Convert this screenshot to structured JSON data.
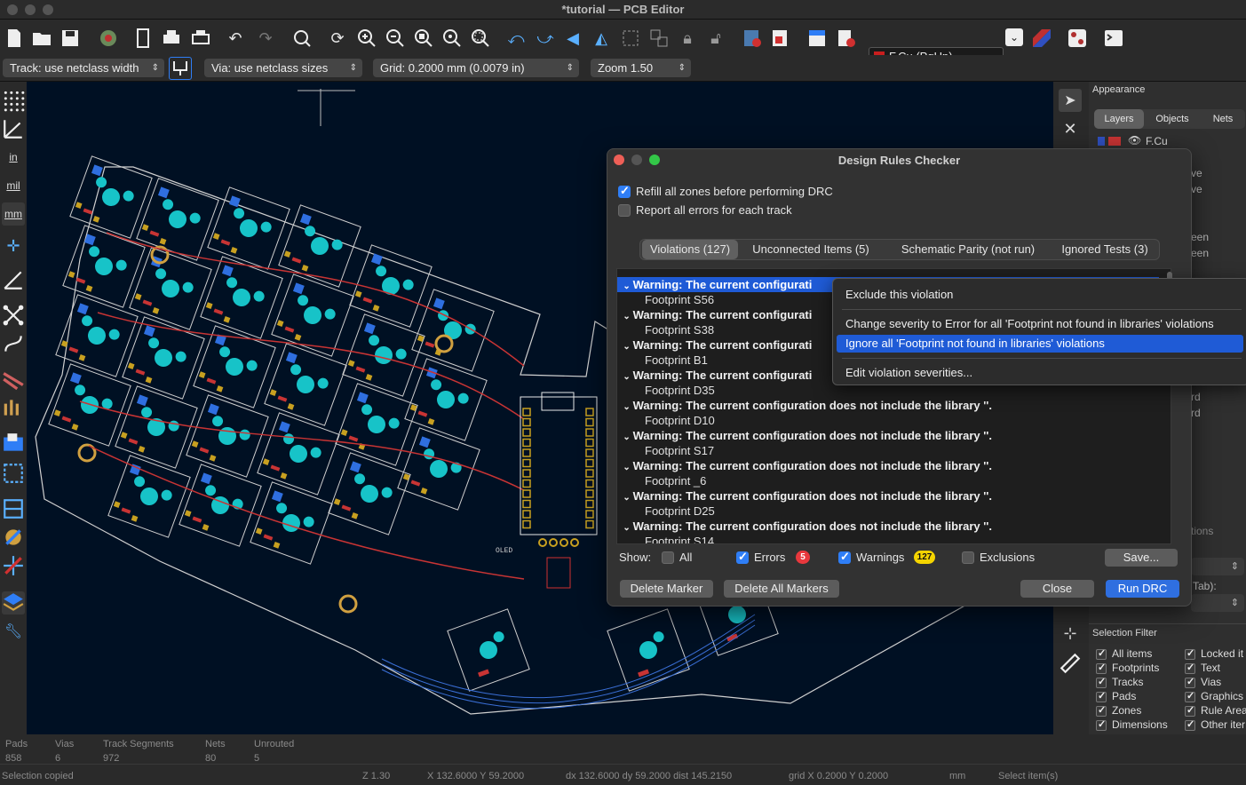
{
  "window": {
    "title": "*tutorial — PCB Editor"
  },
  "toolbar": {
    "layer_selector": "F.Cu (PgUp)",
    "track_width": "Track: use netclass width",
    "via_size": "Via: use netclass sizes",
    "grid": "Grid: 0.2000 mm (0.0079 in)",
    "zoom": "Zoom 1.50"
  },
  "left_tools": {
    "in_label": "in",
    "mil_label": "mil",
    "mm_label": "mm"
  },
  "canvas": {
    "silk_label": "OLED"
  },
  "appearance": {
    "title": "Appearance",
    "tabs": [
      "Layers",
      "Objects",
      "Nets"
    ],
    "first_layer": "F.Cu",
    "peek_texts": [
      "ve",
      "ve",
      "een",
      "een",
      "rd",
      "rd",
      "tions",
      "Tab):"
    ]
  },
  "selection_filter": {
    "title": "Selection Filter",
    "items": [
      "All items",
      "Locked it",
      "Footprints",
      "Text",
      "Tracks",
      "Vias",
      "Pads",
      "Graphics",
      "Zones",
      "Rule Area",
      "Dimensions",
      "Other iter"
    ]
  },
  "drc": {
    "title": "Design Rules Checker",
    "refill_zones": "Refill all zones before performing DRC",
    "report_all_errors": "Report all errors for each track",
    "tabs": [
      "Violations (127)",
      "Unconnected Items (5)",
      "Schematic Parity (not run)",
      "Ignored Tests (3)"
    ],
    "violations": [
      {
        "warning": "Warning: The current configurati",
        "item": "Footprint S56"
      },
      {
        "warning": "Warning: The current configurati",
        "item": "Footprint S38"
      },
      {
        "warning": "Warning: The current configurati",
        "item": "Footprint B1"
      },
      {
        "warning": "Warning: The current configurati",
        "item": "Footprint D35"
      },
      {
        "warning": "Warning: The current configuration does not include the library ''.",
        "item": "Footprint D10"
      },
      {
        "warning": "Warning: The current configuration does not include the library ''.",
        "item": "Footprint S17"
      },
      {
        "warning": "Warning: The current configuration does not include the library ''.",
        "item": "Footprint _6"
      },
      {
        "warning": "Warning: The current configuration does not include the library ''.",
        "item": "Footprint D25"
      },
      {
        "warning": "Warning: The current configuration does not include the library ''.",
        "item": "Footprint S14"
      }
    ],
    "show_label": "Show:",
    "filter_all": "All",
    "filter_errors": "Errors",
    "errors_count": "5",
    "filter_warnings": "Warnings",
    "warnings_count": "127",
    "filter_exclusions": "Exclusions",
    "save_button": "Save...",
    "delete_marker": "Delete Marker",
    "delete_all_markers": "Delete All Markers",
    "close_button": "Close",
    "run_button": "Run DRC"
  },
  "context_menu": {
    "exclude": "Exclude this violation",
    "change_severity": "Change severity to Error for all 'Footprint not found in libraries' violations",
    "ignore_all": "Ignore all 'Footprint not found in libraries' violations",
    "edit_severities": "Edit violation severities..."
  },
  "status": {
    "pads_label": "Pads",
    "pads_value": "858",
    "vias_label": "Vias",
    "vias_value": "6",
    "tracks_label": "Track Segments",
    "tracks_value": "972",
    "nets_label": "Nets",
    "nets_value": "80",
    "unrouted_label": "Unrouted",
    "unrouted_value": "5",
    "message": "Selection copied",
    "zoom": "Z 1.30",
    "coords": "X 132.6000  Y 59.2000",
    "delta": "dx 132.6000  dy 59.2000  dist 145.2150",
    "grid": "grid X 0.2000  Y 0.2000",
    "units": "mm",
    "mode": "Select item(s)"
  },
  "colors": {
    "board_bg": "#001023",
    "copper": "#c83434",
    "pad": "#c8a020",
    "accent": "#2f6fe0"
  }
}
